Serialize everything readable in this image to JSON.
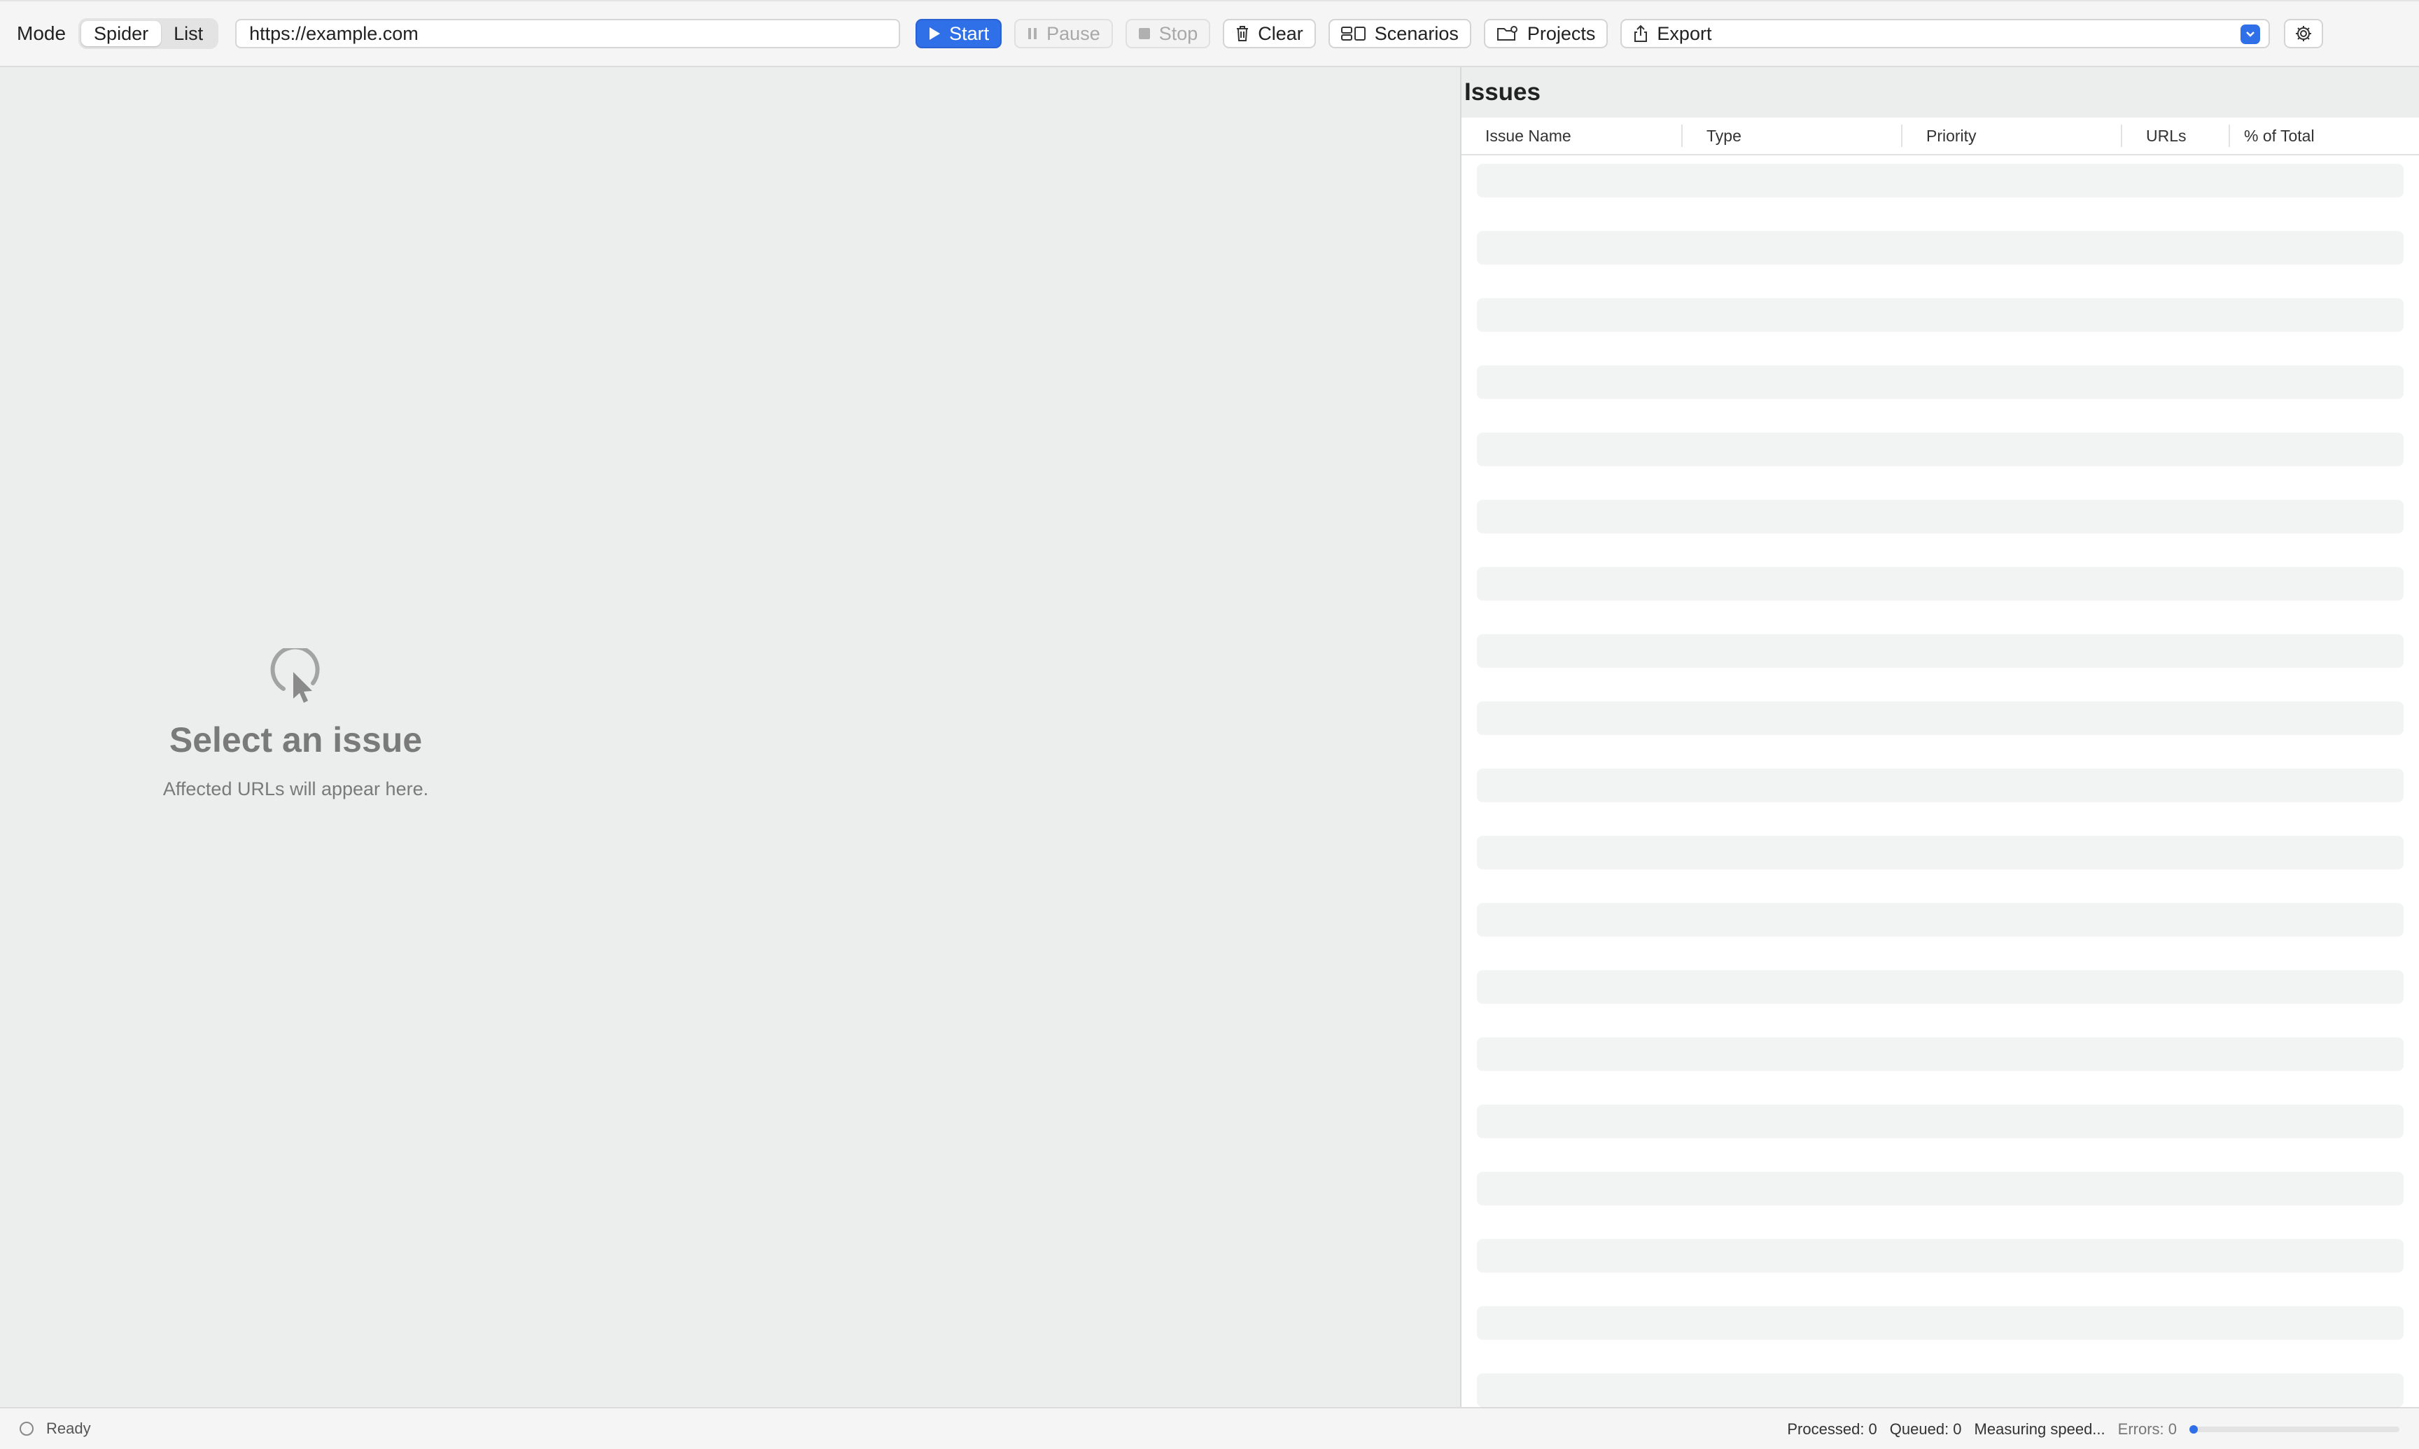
{
  "toolbar": {
    "mode_label": "Mode",
    "mode_options": [
      "Spider",
      "List"
    ],
    "mode_selected": "Spider",
    "url_value": "https://example.com",
    "start_label": "Start",
    "pause_label": "Pause",
    "stop_label": "Stop",
    "clear_label": "Clear",
    "scenarios_label": "Scenarios",
    "projects_label": "Projects",
    "export_label": "Export",
    "icons": {
      "start": "play-icon",
      "pause": "pause-icon",
      "stop": "stop-icon",
      "clear": "trash-icon",
      "scenarios": "scenarios-icon",
      "projects": "folder-icon",
      "export": "share-icon",
      "settings": "gear-icon"
    },
    "accent_color": "#2f6fe8"
  },
  "empty_state": {
    "icon": "cursor-click-icon",
    "title": "Select an issue",
    "subtitle": "Affected URLs will appear here."
  },
  "issues": {
    "title": "Issues",
    "columns": [
      "Issue Name",
      "Type",
      "Priority",
      "URLs",
      "% of Total"
    ],
    "rows": []
  },
  "status_bar": {
    "state": "Ready",
    "processed": "Processed: 0",
    "queued": "Queued: 0",
    "speed": "Measuring speed...",
    "errors": "Errors: 0",
    "progress": 0
  }
}
